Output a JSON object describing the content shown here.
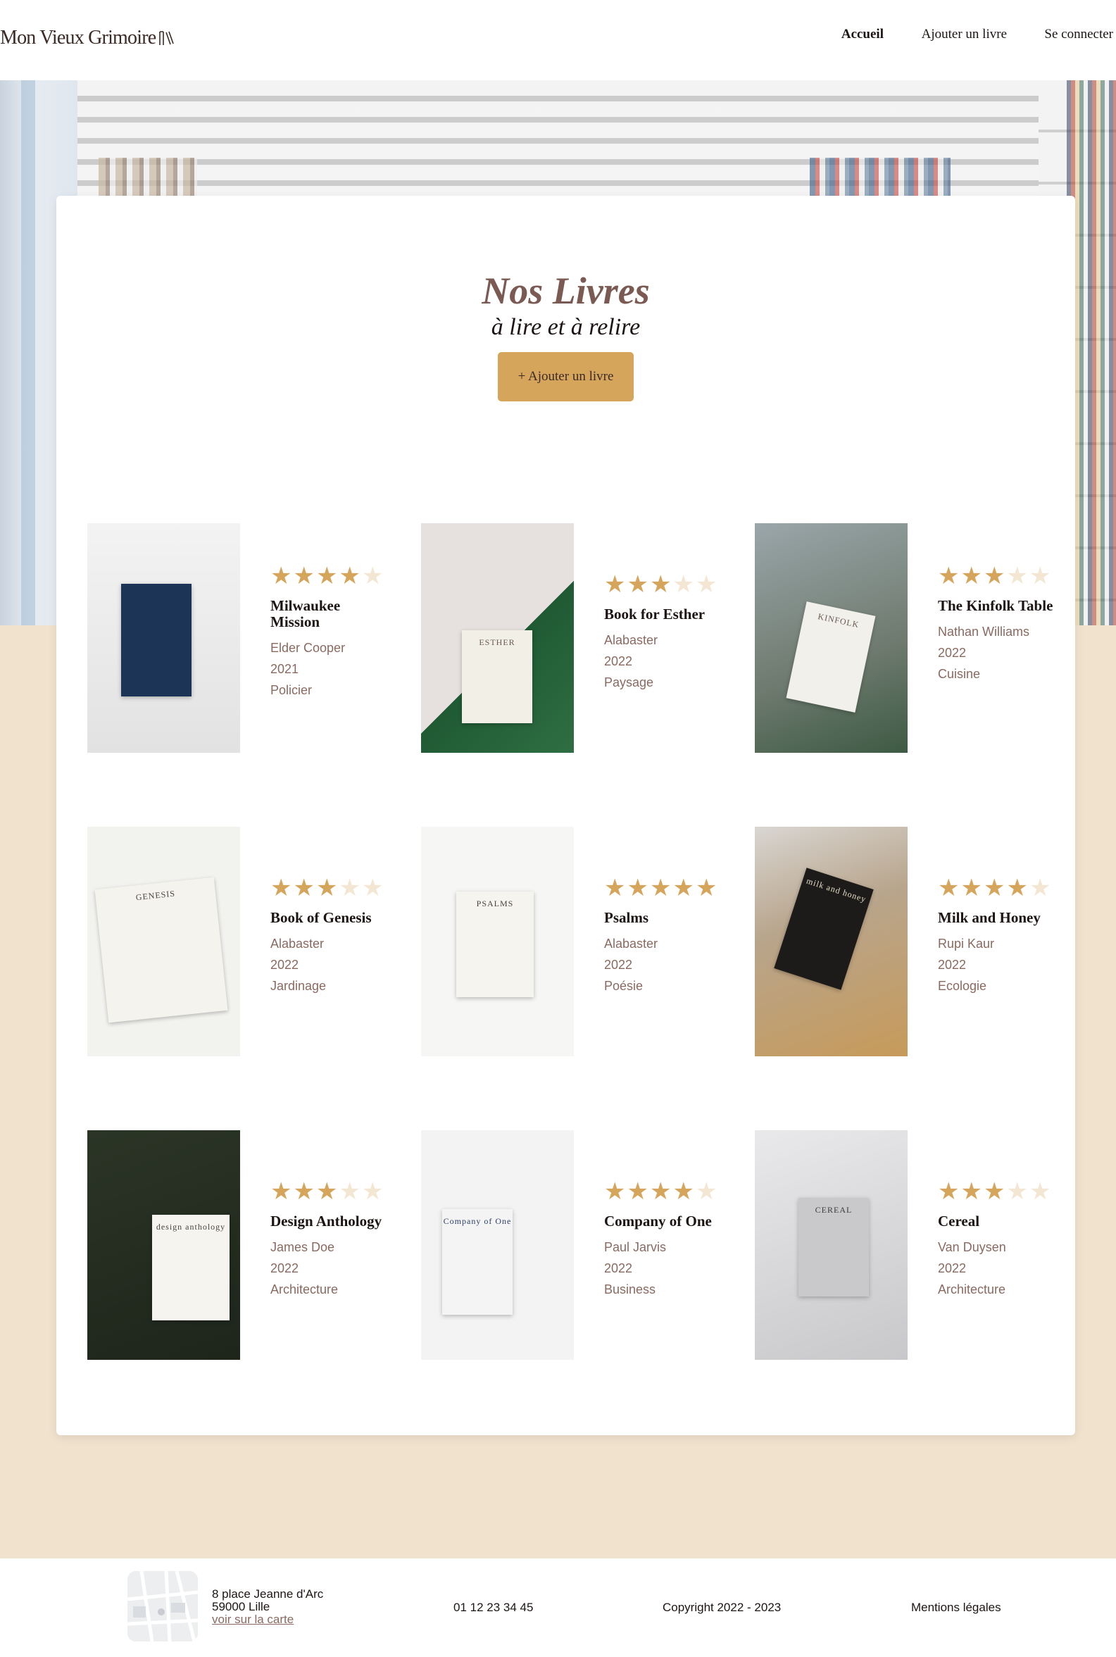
{
  "header": {
    "logo_text": "Mon Vieux Grimoire",
    "nav": [
      {
        "label": "Accueil",
        "active": true
      },
      {
        "label": "Ajouter un livre",
        "active": false
      },
      {
        "label": "Se connecter",
        "active": false
      }
    ]
  },
  "main": {
    "title": "Nos Livres",
    "subtitle": "à lire et à relire",
    "add_button": "+ Ajouter un livre"
  },
  "books": [
    {
      "title": "Milwaukee Mission",
      "author": "Elder Cooper",
      "year": "2021",
      "genre": "Policier",
      "rating": 4
    },
    {
      "title": "Book for Esther",
      "author": "Alabaster",
      "year": "2022",
      "genre": "Paysage",
      "rating": 3
    },
    {
      "title": "The Kinfolk Table",
      "author": "Nathan Williams",
      "year": "2022",
      "genre": "Cuisine",
      "rating": 3
    },
    {
      "title": "Book of Genesis",
      "author": "Alabaster",
      "year": "2022",
      "genre": "Jardinage",
      "rating": 3
    },
    {
      "title": "Psalms",
      "author": "Alabaster",
      "year": "2022",
      "genre": "Poésie",
      "rating": 5
    },
    {
      "title": "Milk and Honey",
      "author": "Rupi Kaur",
      "year": "2022",
      "genre": "Ecologie",
      "rating": 4
    },
    {
      "title": "Design Anthology",
      "author": "James Doe",
      "year": "2022",
      "genre": "Architecture",
      "rating": 3
    },
    {
      "title": "Company of One",
      "author": "Paul Jarvis",
      "year": "2022",
      "genre": "Business",
      "rating": 4
    },
    {
      "title": "Cereal",
      "author": "Van Duysen",
      "year": "2022",
      "genre": "Architecture",
      "rating": 3
    }
  ],
  "covers": [
    {
      "title_text": ""
    },
    {
      "title_text": "ESTHER"
    },
    {
      "title_text": "KINFOLK"
    },
    {
      "title_text": "GENESIS"
    },
    {
      "title_text": "PSALMS"
    },
    {
      "title_text": "milk and honey"
    },
    {
      "title_text": "design anthology"
    },
    {
      "title_text": "Company of One"
    },
    {
      "title_text": "CEREAL"
    }
  ],
  "footer": {
    "address_line1": "8 place Jeanne d'Arc",
    "address_line2": "59000 Lille",
    "map_link": "voir sur la carte",
    "phone": "01 12 23 34 45",
    "copyright": "Copyright 2022 - 2023",
    "legal": "Mentions légales"
  },
  "colors": {
    "accent": "#d6a55c",
    "beige_bg": "#f0e2cd",
    "meta_text": "#8a6a60",
    "title_text": "#7a5a52"
  }
}
